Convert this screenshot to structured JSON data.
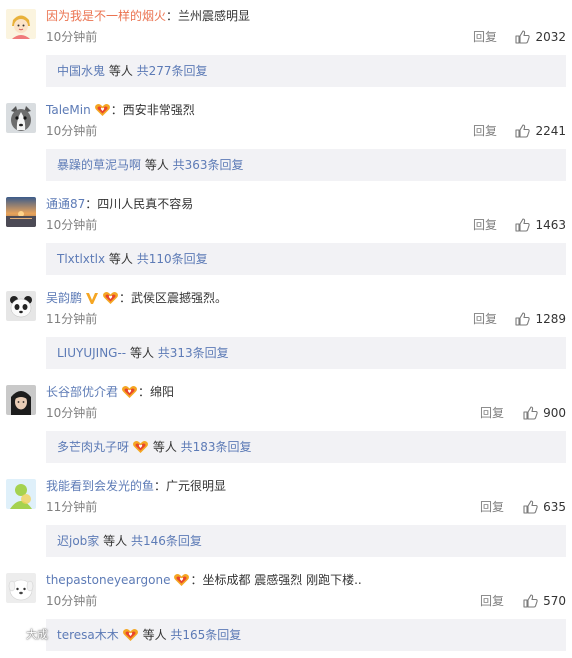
{
  "comments": [
    {
      "username": "因为我是不一样的烟火",
      "username_color": "#eb7350",
      "badge": "",
      "text": "兰州震感明显",
      "time": "10分钟前",
      "reply_label": "回复",
      "likes": "2032",
      "avatar_icon": "cartoon-avatar-icon",
      "sub": {
        "who": "中国水鬼",
        "badge": "",
        "mid": " 等人 ",
        "more": "共277条回复"
      }
    },
    {
      "username": "TaleMin",
      "username_color": "#5d7bb6",
      "badge": "vip-heart-badge-icon",
      "text": "西安非常强烈",
      "time": "10分钟前",
      "reply_label": "回复",
      "likes": "2241",
      "avatar_icon": "dog-avatar-icon",
      "sub": {
        "who": "暴躁的草泥马啊",
        "badge": "",
        "mid": " 等人 ",
        "more": "共363条回复"
      }
    },
    {
      "username": "通通87",
      "username_color": "#5d7bb6",
      "badge": "",
      "text": "四川人民真不容易",
      "time": "10分钟前",
      "reply_label": "回复",
      "likes": "1463",
      "avatar_icon": "sunset-avatar-icon",
      "sub": {
        "who": "Tlxtlxtlx",
        "badge": "",
        "mid": " 等人 ",
        "more": "共110条回复"
      }
    },
    {
      "username": "吴韵鹏",
      "username_color": "#5d7bb6",
      "badge": "verified-v-and-heart-badge-icon",
      "text": "武侯区震撼强烈。",
      "time": "11分钟前",
      "reply_label": "回复",
      "likes": "1289",
      "avatar_icon": "panda-avatar-icon",
      "sub": {
        "who": "LIUYUJING--",
        "badge": "",
        "mid": " 等人 ",
        "more": "共313条回复"
      }
    },
    {
      "username": "长谷部优介君",
      "username_color": "#5d7bb6",
      "badge": "vip-heart-badge-icon",
      "text": "绵阳",
      "time": "10分钟前",
      "reply_label": "回复",
      "likes": "900",
      "avatar_icon": "portrait-avatar-icon",
      "sub": {
        "who": "多芒肉丸子呀",
        "badge": "vip-heart-badge-icon",
        "mid": " 等人 ",
        "more": "共183条回复"
      }
    },
    {
      "username": "我能看到会发光的鱼",
      "username_color": "#5d7bb6",
      "badge": "",
      "text": "广元很明显",
      "time": "11分钟前",
      "reply_label": "回复",
      "likes": "635",
      "avatar_icon": "default-user-avatar-icon",
      "sub": {
        "who": "迟job家",
        "badge": "",
        "mid": " 等人 ",
        "more": "共146条回复"
      }
    },
    {
      "username": "thepastoneyeargone",
      "username_color": "#5d7bb6",
      "badge": "vip-heart-badge-icon",
      "text": "坐标成都 震感强烈 刚跑下楼..",
      "time": "10分钟前",
      "reply_label": "回复",
      "likes": "570",
      "avatar_icon": "white-puppy-avatar-icon",
      "sub": {
        "who": "teresa木木",
        "badge": "vip-heart-badge-icon",
        "mid": " 等人 ",
        "more": "共165条回复"
      }
    }
  ],
  "colors": {
    "link_blue": "#5d7bb6",
    "highlight_orange": "#eb7350",
    "sub_background": "#f2f2f5",
    "meta_gray": "#808080"
  },
  "watermark": {
    "text": "大成",
    "icon": "weibo-watermark-icon"
  }
}
